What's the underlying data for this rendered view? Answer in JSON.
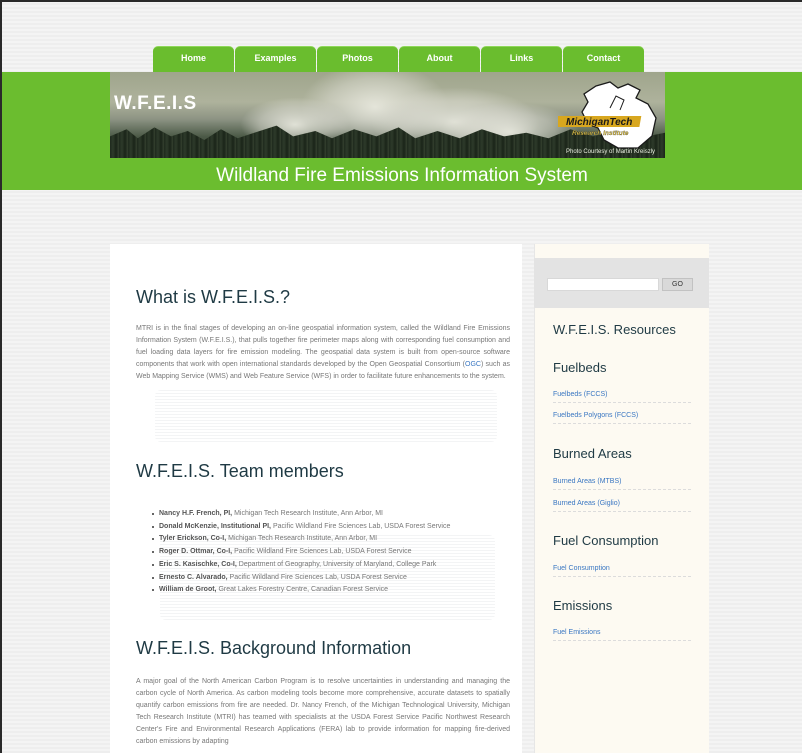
{
  "nav": {
    "tabs": [
      {
        "label": "Home"
      },
      {
        "label": "Examples"
      },
      {
        "label": "Photos"
      },
      {
        "label": "About"
      },
      {
        "label": "Links"
      },
      {
        "label": "Contact"
      }
    ]
  },
  "header": {
    "banner_title": "W.F.E.I.S",
    "logo_line1": "MichiganTech",
    "logo_line2": "Research Institute",
    "photo_credit": "Photo Courtesy of Martin Kreiszly",
    "site_title": "Wildland Fire Emissions Information System"
  },
  "main": {
    "what": {
      "heading": "What is W.F.E.I.S.?",
      "text_before_link": "MTRI is in the final stages of developing an on-line geospatial information system, called the Wildland Fire Emissions Information System (W.F.E.I.S.), that pulls together fire perimeter maps along with corresponding fuel consumption and fuel loading data layers for fire emission modeling. The geospatial data system is built from open-source software components that work with open international standards developed by the Open Geospatial Consortium (",
      "link": "OGC",
      "text_after_link": ") such as Web Mapping Service (WMS) and Web Feature Service (WFS) in order to facilitate future enhancements to the system."
    },
    "team": {
      "heading": "W.F.E.I.S. Team members",
      "members": [
        {
          "name": "Nancy H.F. French, PI,",
          "affiliation": " Michigan Tech Research Institute, Ann Arbor, MI"
        },
        {
          "name": "Donald McKenzie, Institutional PI,",
          "affiliation": " Pacific Wildland Fire Sciences Lab, USDA Forest Service"
        },
        {
          "name": "Tyler Erickson, Co-I,",
          "affiliation": " Michigan Tech Research Institute, Ann Arbor, MI"
        },
        {
          "name": "Roger D. Ottmar, Co-I,",
          "affiliation": " Pacific Wildland Fire Sciences Lab, USDA Forest Service"
        },
        {
          "name": "Eric S. Kasischke, Co-I,",
          "affiliation": " Department of Geography, University of Maryland, College Park"
        },
        {
          "name": "Ernesto C. Alvarado,",
          "affiliation": " Pacific Wildland Fire Sciences Lab, USDA Forest Service"
        },
        {
          "name": "William de Groot,",
          "affiliation": " Great Lakes Forestry Centre, Canadian Forest Service"
        }
      ]
    },
    "background": {
      "heading": "W.F.E.I.S. Background Information",
      "text": "A major goal of the North American Carbon Program is to resolve uncertainties in understanding and managing the carbon cycle of North America. As carbon modeling tools become more comprehensive, accurate datasets to spatially quantify carbon emissions from fire are needed. Dr. Nancy French, of the Michigan Technological University, Michigan Tech Research Institute (MTRI) has teamed with specialists at the USDA Forest Service Pacific Northwest Research Center's Fire and Environmental Research Applications (FERA) lab to provide information for mapping fire-derived carbon emissions by adapting"
    }
  },
  "sidebar": {
    "search": {
      "value": "",
      "button": "GO"
    },
    "resources_heading": "W.F.E.I.S. Resources",
    "fuelbeds": {
      "heading": "Fuelbeds",
      "links": [
        "Fuelbeds (FCCS)",
        "Fuelbeds Polygons (FCCS)"
      ]
    },
    "burned": {
      "heading": "Burned Areas",
      "links": [
        "Burned Areas (MTBS)",
        "Burned Areas (Giglio)"
      ]
    },
    "fuel": {
      "heading": "Fuel Consumption",
      "links": [
        "Fuel Consumption"
      ]
    },
    "emissions": {
      "heading": "Emissions",
      "links": [
        "Fuel Emissions"
      ]
    }
  },
  "colors": {
    "brand_green": "#6bbd2f",
    "heading": "#1f3a44",
    "link": "#3a77c2"
  }
}
